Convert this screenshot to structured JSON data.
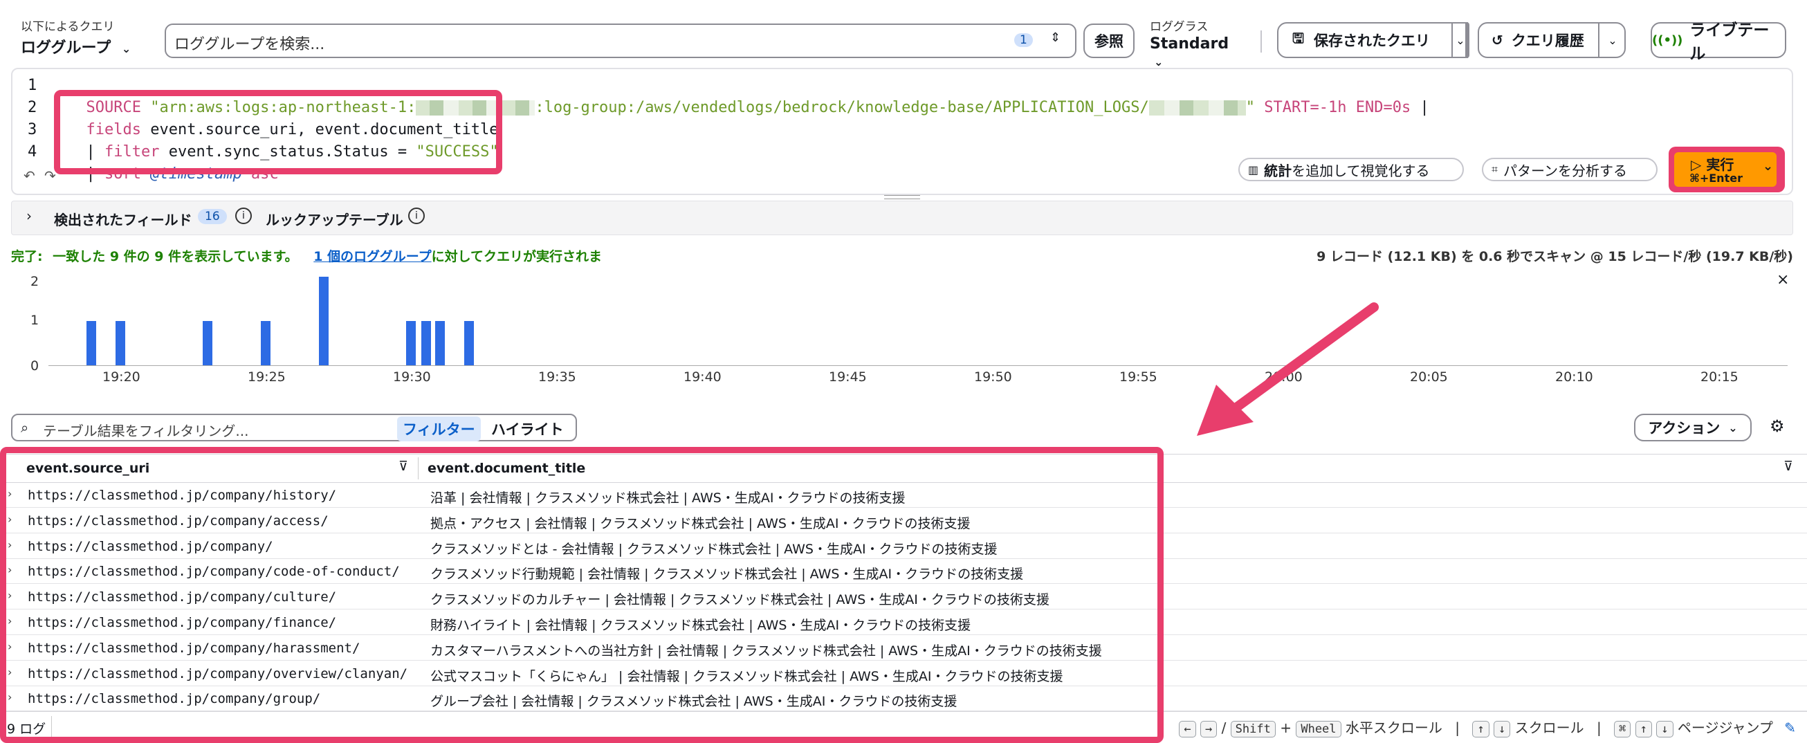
{
  "query_bar": {
    "scope_label": "以下によるクエリ",
    "scope_value": "ロググループ",
    "search_placeholder": "ロググループを検索...",
    "selected_count": "1",
    "browse": "参照",
    "class_label": "ロググラス",
    "class_value": "Standard",
    "saved": "保存されたクエリ",
    "history": "クエリ履歴",
    "live_tail": "ライブテール"
  },
  "editor": {
    "line_numbers": [
      "1",
      "2",
      "3",
      "4"
    ],
    "line1_source": "SOURCE ",
    "line1_arn_a": "\"arn:aws:logs:ap-northeast-1:",
    "line1_arn_b": ":log-group:/aws/vendedlogs/bedrock/knowledge-base/APPLICATION_LOGS/",
    "line1_arn_c": "\"",
    "line1_start": " START",
    "line1_start_val": "=-1h",
    "line1_end": " END",
    "line1_end_val": "=0s",
    "line1_pipe": " |",
    "line2_kw": "fields",
    "line2_rest": " event.source_uri, event.document_title",
    "line3_pipe": "| ",
    "line3_kw": "filter",
    "line3_rest": " event.sync_status.Status = ",
    "line3_str": "\"SUCCESS\"",
    "line4_pipe": "| ",
    "line4_kw": "sort",
    "line4_ts": "@timestamp",
    "line4_dir": " asc",
    "visualize_bold": "統計",
    "visualize_rest": " を追加して視覚化する",
    "pattern": "パターンを分析する",
    "run_label": "実行",
    "run_shortcut": "⌘+Enter"
  },
  "fields_bar": {
    "discovered": "検出されたフィールド",
    "count": "16",
    "lookup": "ルックアップテーブル"
  },
  "status": {
    "complete": "完了:",
    "summary": "一致した 9 件の 9 件を表示しています。",
    "link": "1 個のロググループ",
    "link_suffix": "に対してクエリが実行されま",
    "scan": "9 レコード (12.1 KB) を 0.6 秒でスキャン @ 15 レコード/秒 (19.7 KB/秒)"
  },
  "chart_data": {
    "type": "bar",
    "x_ticks": [
      "19:20",
      "19:25",
      "19:30",
      "19:35",
      "19:40",
      "19:45",
      "19:50",
      "19:55",
      "20:00",
      "20:05",
      "20:10",
      "20:15"
    ],
    "y_ticks": [
      "2",
      "1",
      "0"
    ],
    "ylim": [
      0,
      2
    ],
    "x": [
      "19:19",
      "19:20",
      "19:23",
      "19:25",
      "19:27",
      "19:30",
      "19:30",
      "19:31",
      "19:32"
    ],
    "values": [
      1,
      1,
      1,
      1,
      2,
      1,
      1,
      1,
      1
    ],
    "color": "#2d6be4"
  },
  "results": {
    "filter_placeholder": "テーブル結果をフィルタリング...",
    "mode_filter": "フィルター",
    "mode_highlight": "ハイライト",
    "actions": "アクション",
    "col1": "event.source_uri",
    "col2": "event.document_title",
    "rows": [
      {
        "uri": "https://classmethod.jp/company/history/",
        "title": "沿革 | 会社情報 | クラスメソッド株式会社 | AWS・生成AI・クラウドの技術支援"
      },
      {
        "uri": "https://classmethod.jp/company/access/",
        "title": "拠点・アクセス | 会社情報 | クラスメソッド株式会社 | AWS・生成AI・クラウドの技術支援"
      },
      {
        "uri": "https://classmethod.jp/company/",
        "title": "クラスメソッドとは - 会社情報 | クラスメソッド株式会社 | AWS・生成AI・クラウドの技術支援"
      },
      {
        "uri": "https://classmethod.jp/company/code-of-conduct/",
        "title": "クラスメソッド行動規範 | 会社情報 | クラスメソッド株式会社 | AWS・生成AI・クラウドの技術支援"
      },
      {
        "uri": "https://classmethod.jp/company/culture/",
        "title": "クラスメソッドのカルチャー | 会社情報 | クラスメソッド株式会社 | AWS・生成AI・クラウドの技術支援"
      },
      {
        "uri": "https://classmethod.jp/company/finance/",
        "title": "財務ハイライト | 会社情報 | クラスメソッド株式会社 | AWS・生成AI・クラウドの技術支援"
      },
      {
        "uri": "https://classmethod.jp/company/harassment/",
        "title": "カスタマーハラスメントへの当社方針 | 会社情報 | クラスメソッド株式会社 | AWS・生成AI・クラウドの技術支援"
      },
      {
        "uri": "https://classmethod.jp/company/overview/clanyan/",
        "title": "公式マスコット「くらにゃん」 | 会社情報 | クラスメソッド株式会社 | AWS・生成AI・クラウドの技術支援"
      },
      {
        "uri": "https://classmethod.jp/company/group/",
        "title": "グループ会社 | 会社情報 | クラスメソッド株式会社 | AWS・生成AI・クラウドの技術支援"
      }
    ],
    "log_count": "9 ログ"
  },
  "footer_hints": {
    "slash": "/",
    "shift": "Shift",
    "plus": "+",
    "wheel": "Wheel",
    "h_scroll": "水平スクロール",
    "sep": "|",
    "scroll": "スクロール",
    "page_jump": "ページジャンプ"
  }
}
